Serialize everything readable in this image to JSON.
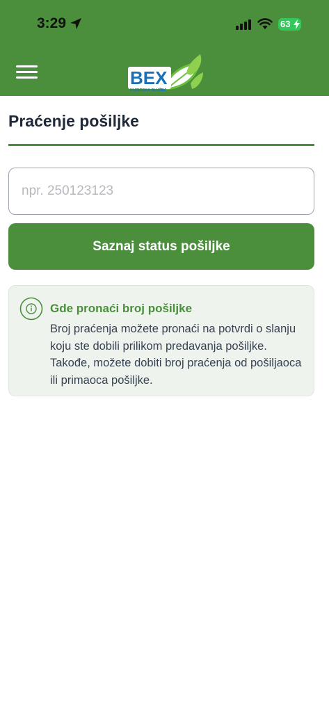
{
  "status_bar": {
    "time": "3:29",
    "battery_level": "63",
    "icons": [
      "location-arrow-icon",
      "signal-icon",
      "wifi-icon",
      "battery-charging-icon"
    ]
  },
  "header": {
    "background_color": "#4b8f3d",
    "logo": {
      "brand_text": "BEX",
      "tagline": "KURIRSKA SLUŽBA"
    },
    "menu_icon": "hamburger-menu-icon"
  },
  "page": {
    "title": "Praćenje pošiljke",
    "accent_color": "#4b8f3d"
  },
  "tracking_form": {
    "input_value": "",
    "input_placeholder": "npr. 250123123",
    "submit_label": "Saznaj status pošiljke"
  },
  "info_box": {
    "icon": "info-circle-icon",
    "title": "Gde pronaći broj pošiljke",
    "text": "Broj praćenja možete pronaći na potvrdi o slanju koju ste dobili prilikom predavanja pošiljke. Takođe, možete dobiti broj praćenja od pošiljaoca ili primaoca pošiljke."
  }
}
